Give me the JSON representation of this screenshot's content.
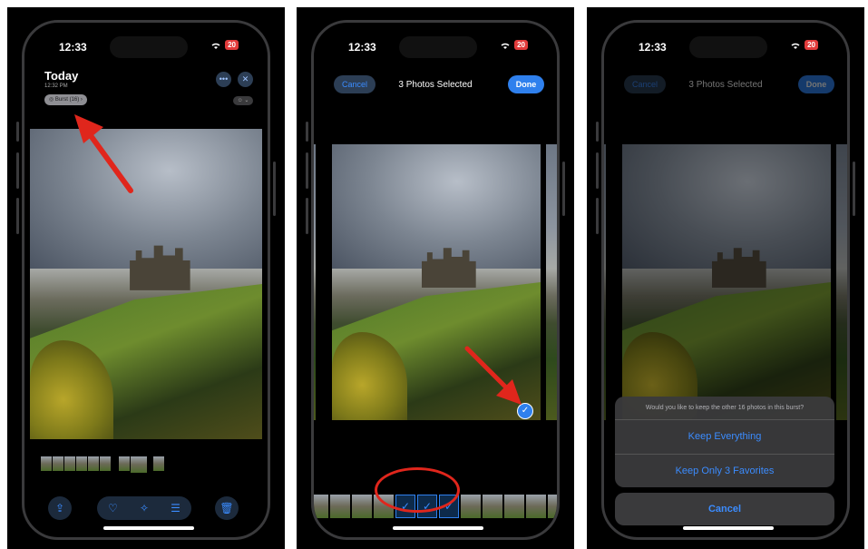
{
  "status": {
    "time": "12:33",
    "battery": "20"
  },
  "panel1": {
    "title": "Today",
    "subtitle": "12:32 PM",
    "burst_label": "Burst (16)",
    "more_icon": "ellipsis-icon",
    "close_icon": "close-icon",
    "toolbar_icons": [
      "share-icon",
      "heart-icon",
      "magic-icon",
      "sliders-icon",
      "trash-icon"
    ]
  },
  "panel2": {
    "cancel_label": "Cancel",
    "title": "3 Photos Selected",
    "done_label": "Done"
  },
  "panel3": {
    "cancel_label": "Cancel",
    "title": "3 Photos Selected",
    "done_label": "Done",
    "sheet_message": "Would you like to keep the other 16 photos in this burst?",
    "keep_everything": "Keep Everything",
    "keep_favorites": "Keep Only 3 Favorites",
    "sheet_cancel": "Cancel"
  },
  "colors": {
    "accent": "#2f80ed",
    "annotation": "#e0261c"
  }
}
